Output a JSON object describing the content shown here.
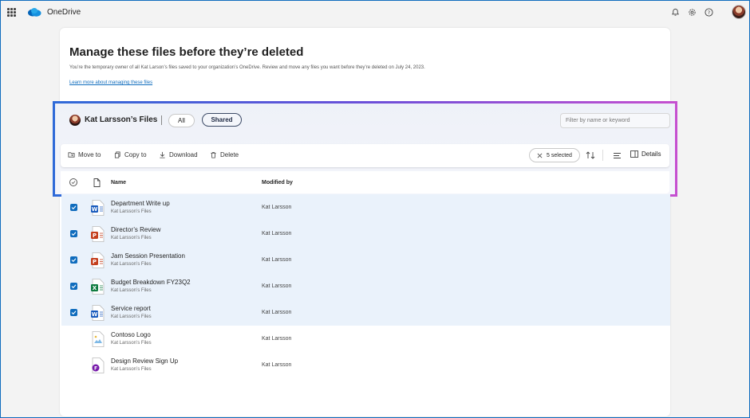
{
  "app": {
    "name": "OneDrive"
  },
  "page": {
    "title": "Manage these files before they’re deleted",
    "description": "You’re the temporary owner of all Kat Larson’s files saved to your organization’s OneDrive. Review and move any files you want before they’re deleted on July 24, 2023.",
    "learn_more": "Learn more about managing these files"
  },
  "owner": {
    "files_label": "Kat Larsson’s Files"
  },
  "filters": {
    "all": "All",
    "shared": "Shared",
    "search_placeholder": "Filter by name or keyword"
  },
  "toolbar": {
    "move_to": "Move to",
    "copy_to": "Copy to",
    "download": "Download",
    "delete": "Delete",
    "selected": "5 selected",
    "details": "Details"
  },
  "columns": {
    "name": "Name",
    "modified_by": "Modified by"
  },
  "files": [
    {
      "name": "Department Write up",
      "location": "Kat Larsson’s Files",
      "modified_by": "Kat Larsson",
      "type": "word",
      "selected": true
    },
    {
      "name": "Director’s Review",
      "location": "Kat Larsson’s Files",
      "modified_by": "Kat Larsson",
      "type": "powerpoint",
      "selected": true
    },
    {
      "name": "Jam Session Presentation",
      "location": "Kat Larsson’s Files",
      "modified_by": "Kat Larsson",
      "type": "powerpoint",
      "selected": true
    },
    {
      "name": "Budget Breakdown FY23Q2",
      "location": "Kat Larsson’s Files",
      "modified_by": "Kat Larsson",
      "type": "excel",
      "selected": true
    },
    {
      "name": "Service report",
      "location": "Kat Larsson’s Files",
      "modified_by": "Kat Larsson",
      "type": "word",
      "selected": true
    },
    {
      "name": "Contoso Logo",
      "location": "Kat Larsson’s Files",
      "modified_by": "Kat Larsson",
      "type": "image",
      "selected": false
    },
    {
      "name": "Design Review Sign Up",
      "location": "Kat Larsson’s Files",
      "modified_by": "Kat Larsson",
      "type": "forms",
      "selected": false
    }
  ],
  "colors": {
    "accent": "#0f6cbd",
    "word": "#185abd",
    "powerpoint": "#c43e1c",
    "excel": "#107c41",
    "forms": "#7719aa",
    "selected_row": "#eaf2fb"
  }
}
